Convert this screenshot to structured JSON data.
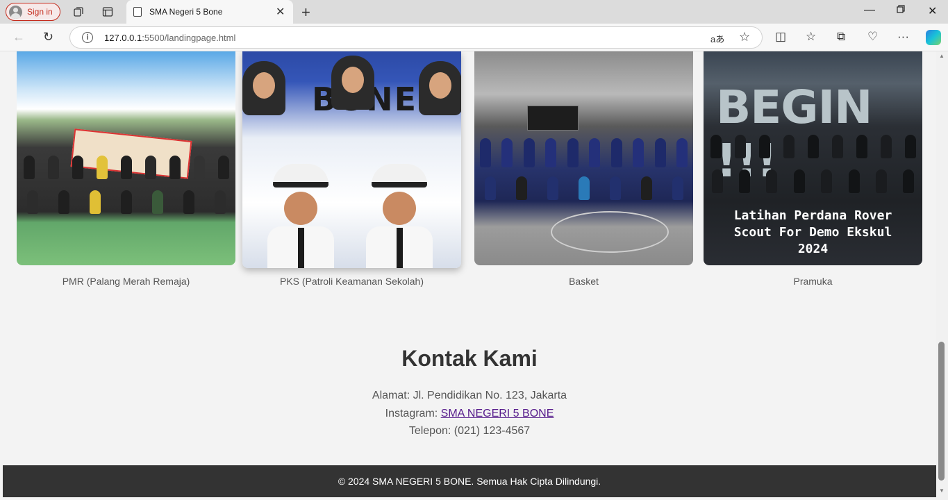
{
  "browser": {
    "signin_label": "Sign in",
    "tab_title": "SMA Negeri 5 Bone",
    "url_host": "127.0.0.1",
    "url_path": ":5500/landingpage.html"
  },
  "activities": [
    {
      "caption": "PMR (Palang Merah Remaja)"
    },
    {
      "caption": "PKS (Patroli Keamanan Sekolah)"
    },
    {
      "caption": "Basket"
    },
    {
      "caption": "Pramuka"
    }
  ],
  "photo_text": {
    "pks_banner": "BONE",
    "pramuka_headline": "BEGIN !!!",
    "pramuka_line1": "Latihan Perdana Rover",
    "pramuka_line2": "Scout For Demo Ekskul",
    "pramuka_line3": "2024"
  },
  "contact": {
    "title": "Kontak Kami",
    "address": "Alamat: Jl. Pendidikan No. 123, Jakarta",
    "instagram_label": "Instagram: ",
    "instagram_link": "SMA NEGERI 5 BONE",
    "phone": "Telepon: (021) 123-4567"
  },
  "footer": {
    "text": "© 2024 SMA NEGERI 5 BONE. Semua Hak Cipta Dilindungi."
  },
  "colors": {
    "signin_accent": "#c42b1c",
    "footer_bg": "#333333",
    "link": "#551a8b"
  }
}
